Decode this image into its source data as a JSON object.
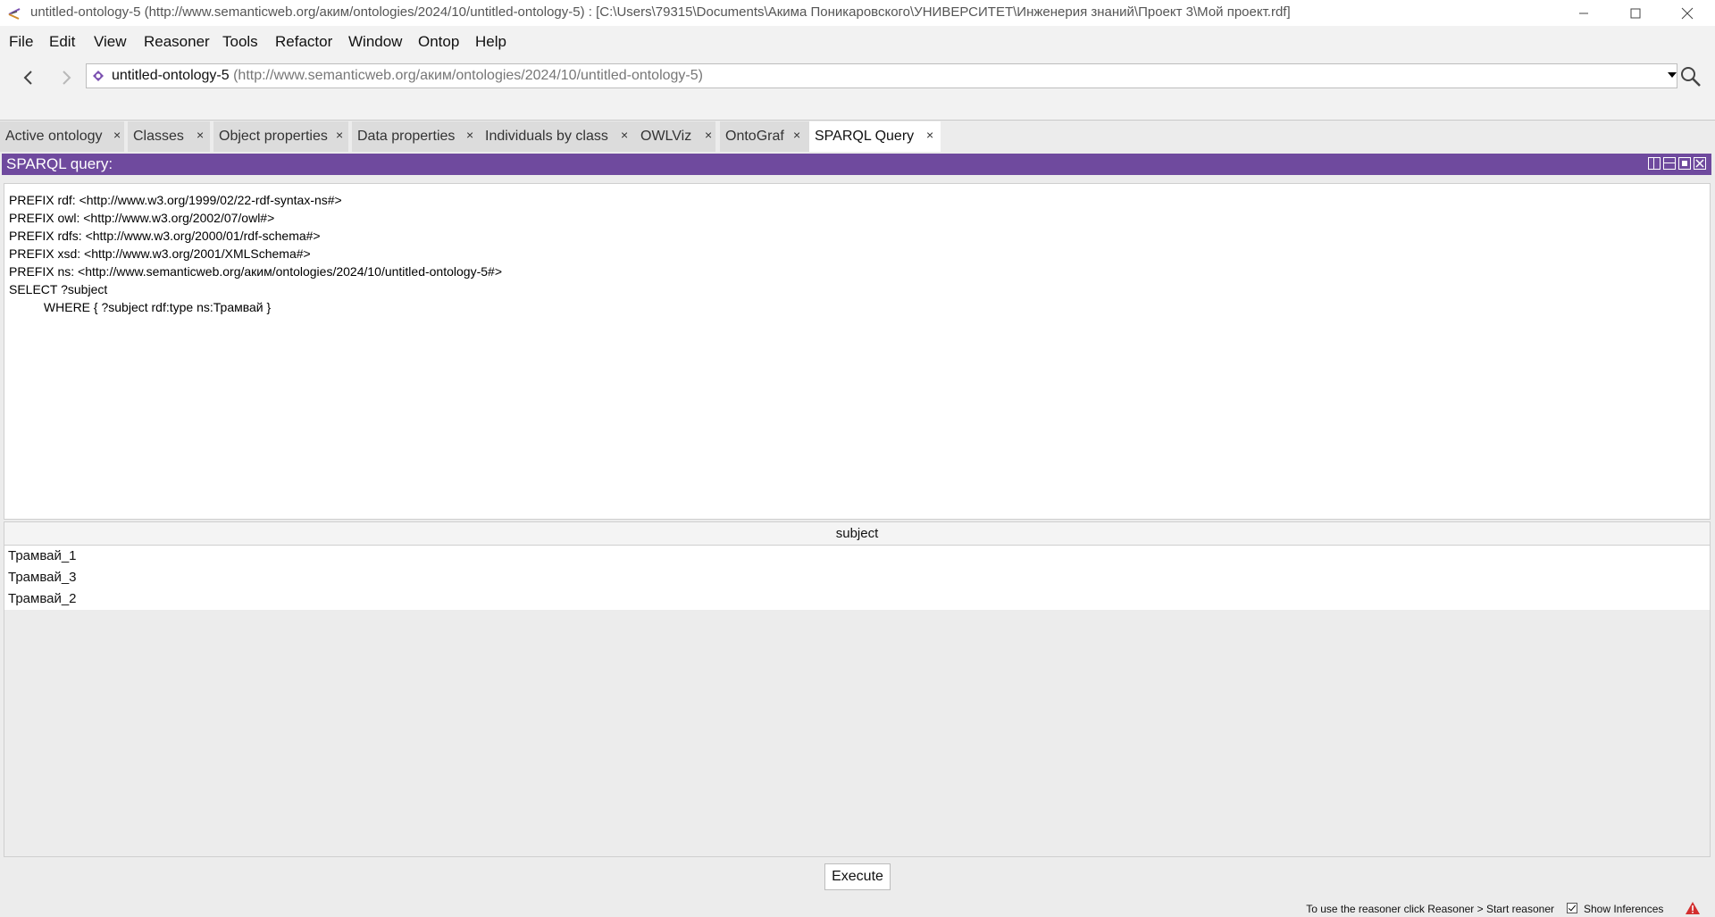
{
  "window": {
    "title": "untitled-ontology-5 (http://www.semanticweb.org/аким/ontologies/2024/10/untitled-ontology-5)  : [C:\\Users\\79315\\Documents\\Акима Поникаровского\\УНИВЕРСИТЕТ\\Инженерия знаний\\Проект 3\\Мой проект.rdf]"
  },
  "menu": [
    "File",
    "Edit",
    "View",
    "Reasoner",
    "Tools",
    "Refactor",
    "Window",
    "Ontop",
    "Help"
  ],
  "address": {
    "name": "untitled-ontology-5",
    "iri": "(http://www.semanticweb.org/аким/ontologies/2024/10/untitled-ontology-5)"
  },
  "tabs": [
    {
      "label": "Active ontology",
      "active": false
    },
    {
      "label": "Classes",
      "active": false
    },
    {
      "label": "Object properties",
      "active": false
    },
    {
      "label": "Data properties",
      "active": false
    },
    {
      "label": "Individuals by class",
      "active": false
    },
    {
      "label": "OWLViz",
      "active": false
    },
    {
      "label": "OntoGraf",
      "active": false
    },
    {
      "label": "SPARQL Query",
      "active": true
    }
  ],
  "view": {
    "header": "SPARQL query:",
    "header_color": "#6f4a9e"
  },
  "query_lines": [
    "PREFIX rdf: <http://www.w3.org/1999/02/22-rdf-syntax-ns#>",
    "PREFIX owl: <http://www.w3.org/2002/07/owl#>",
    "PREFIX rdfs: <http://www.w3.org/2000/01/rdf-schema#>",
    "PREFIX xsd: <http://www.w3.org/2001/XMLSchema#>",
    "PREFIX ns: <http://www.semanticweb.org/аким/ontologies/2024/10/untitled-ontology-5#>",
    "SELECT ?subject",
    "\t\tWHERE { ?subject rdf:type ns:Трамвай }"
  ],
  "results": {
    "column": "subject",
    "rows": [
      "Трамвай_1",
      "Трамвай_3",
      "Трамвай_2"
    ]
  },
  "execute_label": "Execute",
  "status": {
    "message": "To use the reasoner click Reasoner > Start reasoner",
    "show_inferences_label": "Show Inferences",
    "show_inferences_checked": true
  }
}
